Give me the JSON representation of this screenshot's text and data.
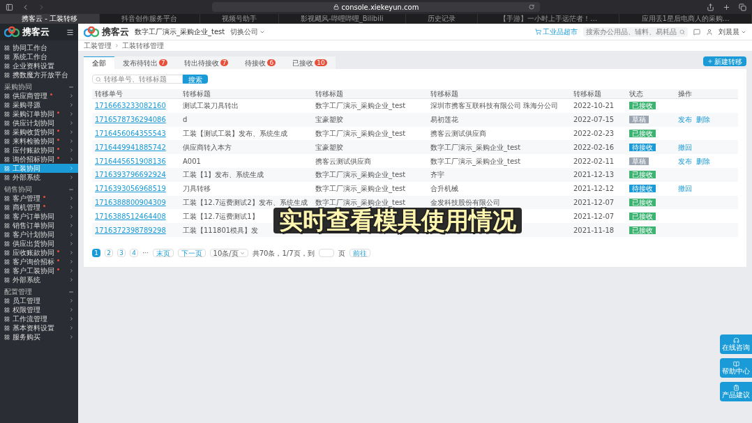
{
  "browser": {
    "url": "console.xiekeyun.com",
    "tabs": [
      {
        "title": "携客云 - 工装转移",
        "selected": true
      },
      {
        "title": "抖音创作服务平台",
        "selected": false
      },
      {
        "title": "视频号助手",
        "selected": false
      },
      {
        "title": "影视飓风-哔哩哔哩_Bilibili",
        "selected": false
      },
      {
        "title": "历史记录",
        "selected": false
      },
      {
        "title": "【手游】一小时上手远茫者！…",
        "selected": false
      },
      {
        "title": "应用丢1星后电商人的采购…",
        "selected": false
      }
    ]
  },
  "sidebar": {
    "logo": "携客云",
    "top_items": [
      "协同工作台",
      "系统工作台",
      "企业资料设置",
      "携数魔方开放平台"
    ],
    "sections": [
      {
        "title": "采购协同",
        "items": [
          {
            "label": "供应商管理",
            "dot": true,
            "selected": false
          },
          {
            "label": "采购寻源",
            "dot": false,
            "selected": false
          },
          {
            "label": "采购订单协同",
            "dot": true,
            "selected": false
          },
          {
            "label": "供应计划协同",
            "dot": false,
            "selected": false
          },
          {
            "label": "采购收货协同",
            "dot": true,
            "selected": false
          },
          {
            "label": "来料检验协同",
            "dot": true,
            "selected": false
          },
          {
            "label": "应付账款协同",
            "dot": true,
            "selected": false
          },
          {
            "label": "询价招标协同",
            "dot": true,
            "selected": false
          },
          {
            "label": "工装协同",
            "dot": false,
            "selected": true
          },
          {
            "label": "外部系统",
            "dot": false,
            "selected": false
          }
        ]
      },
      {
        "title": "销售协同",
        "items": [
          {
            "label": "客户管理",
            "dot": true,
            "selected": false
          },
          {
            "label": "商机管理",
            "dot": true,
            "selected": false
          },
          {
            "label": "客户订单协同",
            "dot": false,
            "selected": false
          },
          {
            "label": "销售订单协同",
            "dot": false,
            "selected": false
          },
          {
            "label": "客户计划协同",
            "dot": false,
            "selected": false
          },
          {
            "label": "供应出货协同",
            "dot": false,
            "selected": false
          },
          {
            "label": "应收账款协同",
            "dot": true,
            "selected": false
          },
          {
            "label": "客户询价招标",
            "dot": true,
            "selected": false
          },
          {
            "label": "客户工装协同",
            "dot": true,
            "selected": false
          },
          {
            "label": "外部系统",
            "dot": false,
            "selected": false
          }
        ]
      },
      {
        "title": "配置管理",
        "items": [
          {
            "label": "员工管理",
            "dot": false,
            "selected": false
          },
          {
            "label": "权限管理",
            "dot": false,
            "selected": false
          },
          {
            "label": "工作流管理",
            "dot": false,
            "selected": false
          },
          {
            "label": "基本资料设置",
            "dot": false,
            "selected": false
          },
          {
            "label": "服务购买",
            "dot": false,
            "selected": false
          }
        ]
      }
    ]
  },
  "header": {
    "logo": "携客云",
    "company": "数字工厂演示_采购企业_test",
    "switch": "切换公司",
    "market": "工业品超市",
    "search_placeholder": "搜索办公用品、辅料、易耗品",
    "user": "刘晨晨"
  },
  "breadcrumb": [
    "工装管理",
    "工装转移管理"
  ],
  "tabs": [
    {
      "label": "全部",
      "selected": true
    },
    {
      "label": "发布待转出",
      "badge": "7",
      "selected": false
    },
    {
      "label": "转出待接收",
      "badge": "7",
      "selected": false
    },
    {
      "label": "待接收",
      "badge": "6",
      "selected": false
    },
    {
      "label": "已接收",
      "badge": "10",
      "selected": false
    }
  ],
  "new_button": "新建转移",
  "search": {
    "placeholder": "转移单号、转移标题",
    "button": "搜索"
  },
  "table": {
    "columns": [
      "转移单号",
      "转移标题",
      "转移标题",
      "转移标题",
      "转移标题",
      "状态",
      "操作"
    ],
    "rows": [
      {
        "id": "1716663233082160",
        "title": "测试工装刀具转出",
        "from": "数字工厂演示_采购企业_test",
        "to": "深圳市携客互联科技有限公司 珠海分公司",
        "date": "2022-10-21",
        "status": {
          "label": "已接收",
          "kind": "received"
        },
        "actions": []
      },
      {
        "id": "1716578736294086",
        "title": "d",
        "from": "宝豪塑胶",
        "to": "易初莲花",
        "date": "2022-07-15",
        "status": {
          "label": "草稿",
          "kind": "draft"
        },
        "actions": [
          "发布",
          "删除"
        ]
      },
      {
        "id": "1716456064355543",
        "title": "工装【测试工装】发布、系统生成",
        "from": "数字工厂演示_采购企业_test",
        "to": "携客云测试供应商",
        "date": "2022-02-23",
        "status": {
          "label": "已接收",
          "kind": "received"
        },
        "actions": []
      },
      {
        "id": "1716449941885742",
        "title": "供应商转入本方",
        "from": "宝豪塑胶",
        "to": "数字工厂演示_采购企业_test",
        "date": "2022-02-16",
        "status": {
          "label": "待接收",
          "kind": "pending"
        },
        "actions": [
          "撤回"
        ]
      },
      {
        "id": "1716445651908136",
        "title": "A001",
        "from": "携客云测试供应商",
        "to": "数字工厂演示_采购企业_test",
        "date": "2022-02-11",
        "status": {
          "label": "草稿",
          "kind": "draft"
        },
        "actions": [
          "发布",
          "删除"
        ]
      },
      {
        "id": "1716393796692924",
        "title": "工装【1】发布、系统生成",
        "from": "数字工厂演示_采购企业_test",
        "to": "齐宇",
        "date": "2021-12-13",
        "status": {
          "label": "已接收",
          "kind": "received"
        },
        "actions": []
      },
      {
        "id": "1716393056968519",
        "title": "刀具转移",
        "from": "数字工厂演示_采购企业_test",
        "to": "合升机械",
        "date": "2021-12-12",
        "status": {
          "label": "待接收",
          "kind": "pending"
        },
        "actions": [
          "撤回"
        ]
      },
      {
        "id": "1716388800904309",
        "title": "工装【12.7运费测试2】发布、系统生成",
        "from": "数字工厂演示_采购企业_test",
        "to": "金发科技股份有限公司",
        "date": "2021-12-07",
        "status": {
          "label": "已接收",
          "kind": "received"
        },
        "actions": []
      },
      {
        "id": "1716388512464408",
        "title": "工装【12.7运费测试1】",
        "date": "2021-12-07",
        "status": {
          "label": "已接收",
          "kind": "received"
        },
        "actions": []
      },
      {
        "id": "1716372398789298",
        "title": "工装【111801模具】发",
        "date": "2021-11-18",
        "status": {
          "label": "已接收",
          "kind": "received"
        },
        "actions": []
      }
    ]
  },
  "pagination": {
    "pages": [
      {
        "label": "1",
        "selected": true
      },
      {
        "label": "2",
        "selected": false
      },
      {
        "label": "3",
        "selected": false
      },
      {
        "label": "4",
        "selected": false
      }
    ],
    "ellipsis": "···",
    "last": "末页",
    "next": "下一页",
    "page_size": "10条/页",
    "summary": "共70条，1/7页，到",
    "unit": "页",
    "go": "前往"
  },
  "float_buttons": [
    "在线咨询",
    "帮助中心",
    "产品建议"
  ],
  "caption": "实时查看模具使用情况"
}
